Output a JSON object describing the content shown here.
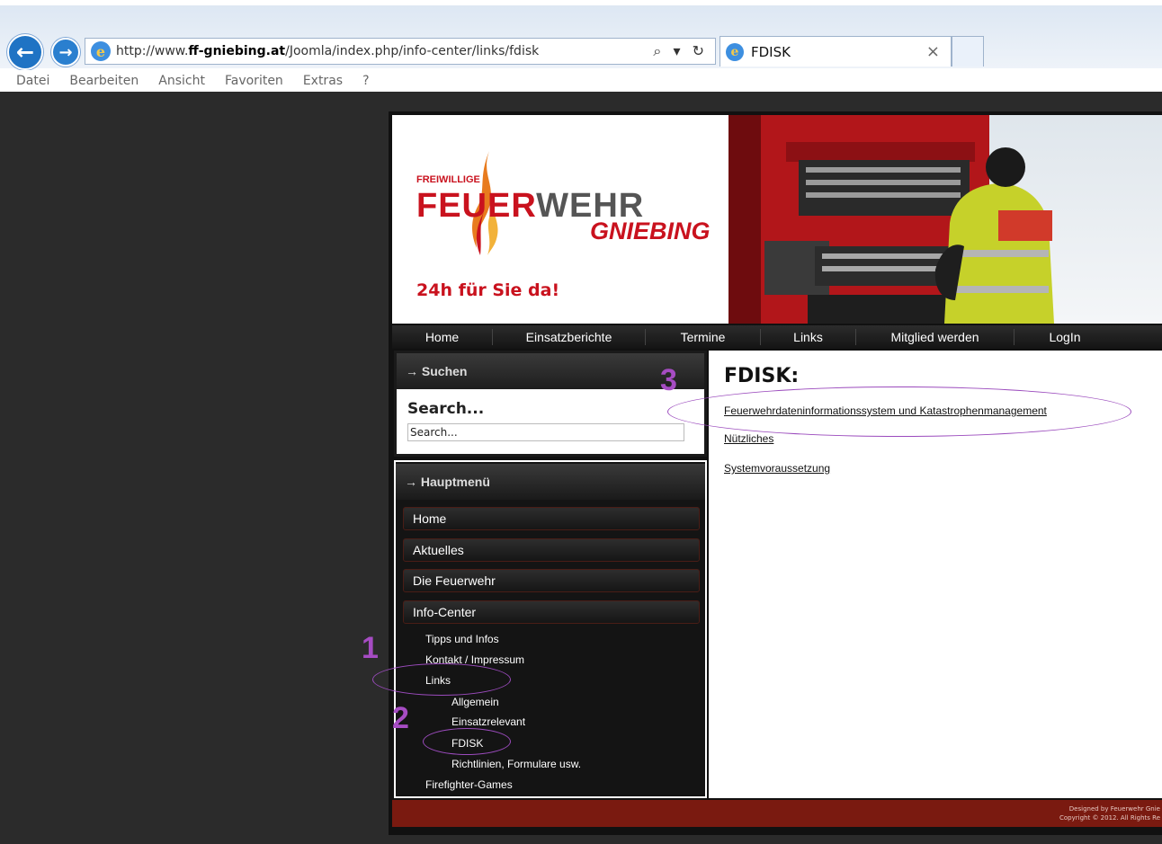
{
  "browser": {
    "url_prefix": "http://www.",
    "url_domain": "ff-gniebing.at",
    "url_path": "/Joomla/index.php/info-center/links/fdisk",
    "address_tools": "⌕ ▾ ↻",
    "tab_title": "FDISK",
    "tab_close": "×",
    "menu": [
      "Datei",
      "Bearbeiten",
      "Ansicht",
      "Favoriten",
      "Extras",
      "?"
    ]
  },
  "banner": {
    "logo_small": "FREIWILLIGE",
    "logo_red": "FEUER",
    "logo_grey": "WEHR",
    "logo_sub": "GNIEBING",
    "tagline": "24h für Sie da!"
  },
  "nav": {
    "items": [
      "Home",
      "Einsatzberichte",
      "Termine",
      "Links",
      "Mitglied werden",
      "LogIn"
    ]
  },
  "sidebar": {
    "search_heading": "→ Suchen",
    "search_label": "Search...",
    "search_placeholder": "Search...",
    "menu_heading": "→ Hauptmenü",
    "menu_items": [
      "Home",
      "Aktuelles",
      "Die Feuerwehr",
      "Info-Center"
    ],
    "sub_items": [
      "Tipps und Infos",
      "Kontakt / Impressum",
      "Links",
      "Allgemein",
      "Einsatzrelevant",
      "FDISK",
      "Richtlinien, Formulare usw.",
      "Firefighter-Games"
    ]
  },
  "content": {
    "title": "FDISK:",
    "links": [
      "Feuerwehrdateninformationssystem und Katastrophenmanagement",
      "Nützliches",
      "Systemvoraussetzung"
    ]
  },
  "footer": {
    "line1": "Designed by Feuerwehr Gnie",
    "line2": "Copyright © 2012. All Rights Re"
  },
  "annotations": {
    "num1": "1",
    "num2": "2",
    "num3": "3",
    "color": "#a64cc3"
  }
}
